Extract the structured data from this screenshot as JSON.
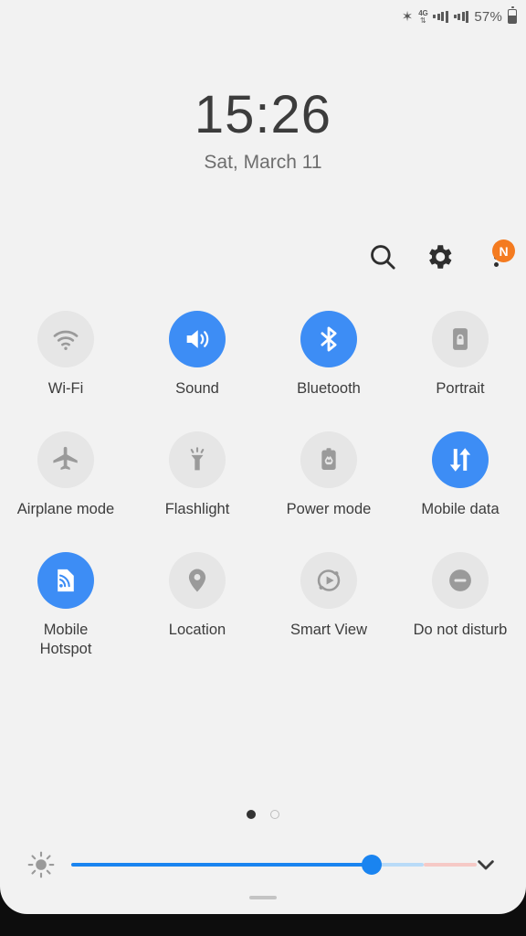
{
  "statusbar": {
    "bluetooth_icon": "bluetooth-icon",
    "network_label": "4G",
    "data_arrows": "⇅",
    "signal_icon_1": "signal-bars-icon",
    "signal_icon_2": "signal-bars-icon",
    "battery_percent": "57%",
    "battery_icon": "battery-icon"
  },
  "clock": {
    "time": "15:26",
    "date": "Sat, March 11"
  },
  "header": {
    "search_icon": "search-icon",
    "settings_icon": "gear-icon",
    "menu_icon": "more-vertical-icon",
    "badge_label": "N"
  },
  "tiles": [
    {
      "label": "Wi-Fi",
      "icon": "wifi-icon",
      "state": "off"
    },
    {
      "label": "Sound",
      "icon": "volume-icon",
      "state": "on"
    },
    {
      "label": "Bluetooth",
      "icon": "bluetooth-icon",
      "state": "on"
    },
    {
      "label": "Portrait",
      "icon": "rotation-lock-icon",
      "state": "off"
    },
    {
      "label": "Airplane mode",
      "icon": "airplane-icon",
      "state": "off"
    },
    {
      "label": "Flashlight",
      "icon": "flashlight-icon",
      "state": "off"
    },
    {
      "label": "Power mode",
      "icon": "power-mode-icon",
      "state": "off"
    },
    {
      "label": "Mobile data",
      "icon": "data-arrows-icon",
      "state": "on"
    },
    {
      "label": "Mobile Hotspot",
      "icon": "hotspot-icon",
      "state": "on"
    },
    {
      "label": "Location",
      "icon": "location-pin-icon",
      "state": "off"
    },
    {
      "label": "Smart View",
      "icon": "smart-view-icon",
      "state": "off"
    },
    {
      "label": "Do not disturb",
      "icon": "do-not-disturb-icon",
      "state": "off"
    }
  ],
  "pager": {
    "current_page": 1,
    "total_pages": 2
  },
  "brightness": {
    "icon": "brightness-icon",
    "expand_icon": "chevron-down-icon",
    "value_percent": 75
  },
  "handle": {
    "name": "drag-handle"
  },
  "colors": {
    "accent_blue": "#3d8df5",
    "slider_blue": "#1a84f0",
    "badge_orange": "#f47b20",
    "panel_bg": "#f2f2f2",
    "tile_off_bg": "#e6e6e6"
  }
}
